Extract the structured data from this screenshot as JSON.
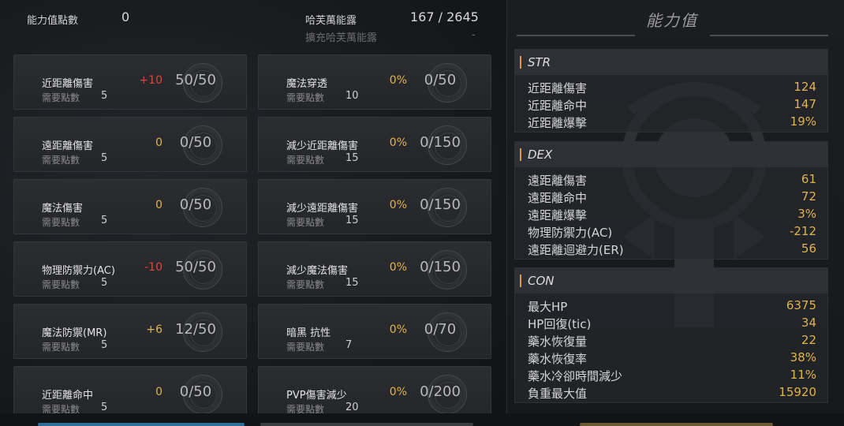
{
  "header": {
    "points_label": "能力值點數",
    "points_value": "0",
    "energy_label": "哈芙萬能露",
    "energy_value": "167 / 2645",
    "expand_label": "擴充哈芙萬能露",
    "expand_value": "-"
  },
  "skills_left": [
    {
      "name": "近距離傷害",
      "req_label": "需要點數",
      "req": "5",
      "bonus": "+10",
      "level": "50/50",
      "tone": "red"
    },
    {
      "name": "遠距離傷害",
      "req_label": "需要點數",
      "req": "5",
      "bonus": "0",
      "level": "0/50",
      "tone": "gold"
    },
    {
      "name": "魔法傷害",
      "req_label": "需要點數",
      "req": "5",
      "bonus": "0",
      "level": "0/50",
      "tone": "gold"
    },
    {
      "name": "物理防禦力(AC)",
      "req_label": "需要點數",
      "req": "5",
      "bonus": "-10",
      "level": "50/50",
      "tone": "red"
    },
    {
      "name": "魔法防禦(MR)",
      "req_label": "需要點數",
      "req": "5",
      "bonus": "+6",
      "level": "12/50",
      "tone": "gold"
    },
    {
      "name": "近距離命中",
      "req_label": "需要點數",
      "req": "5",
      "bonus": "0",
      "level": "0/50",
      "tone": "gold"
    }
  ],
  "skills_right": [
    {
      "name": "魔法穿透",
      "req_label": "需要點數",
      "req": "10",
      "bonus": "0%",
      "level": "0/50",
      "tone": "gold"
    },
    {
      "name": "減少近距離傷害",
      "req_label": "需要點數",
      "req": "15",
      "bonus": "0%",
      "level": "0/150",
      "tone": "gold"
    },
    {
      "name": "減少遠距離傷害",
      "req_label": "需要點數",
      "req": "15",
      "bonus": "0%",
      "level": "0/150",
      "tone": "gold"
    },
    {
      "name": "減少魔法傷害",
      "req_label": "需要點數",
      "req": "15",
      "bonus": "0%",
      "level": "0/150",
      "tone": "gold"
    },
    {
      "name": "暗黑 抗性",
      "req_label": "需要點數",
      "req": "7",
      "bonus": "0%",
      "level": "0/70",
      "tone": "gold"
    },
    {
      "name": "PVP傷害減少",
      "req_label": "需要點數",
      "req": "20",
      "bonus": "0%",
      "level": "0/200",
      "tone": "gold"
    }
  ],
  "stats_panel": {
    "title": "能力值",
    "sections": [
      {
        "label": "STR",
        "rows": [
          {
            "name": "近距離傷害",
            "value": "124"
          },
          {
            "name": "近距離命中",
            "value": "147"
          },
          {
            "name": "近距離爆擊",
            "value": "19%"
          }
        ]
      },
      {
        "label": "DEX",
        "rows": [
          {
            "name": "遠距離傷害",
            "value": "61"
          },
          {
            "name": "遠距離命中",
            "value": "72"
          },
          {
            "name": "遠距離爆擊",
            "value": "3%"
          },
          {
            "name": "物理防禦力(AC)",
            "value": "-212"
          },
          {
            "name": "遠距離迴避力(ER)",
            "value": "56"
          }
        ]
      },
      {
        "label": "CON",
        "rows": [
          {
            "name": "最大HP",
            "value": "6375"
          },
          {
            "name": "HP回復(tic)",
            "value": "34"
          },
          {
            "name": "藥水恢復量",
            "value": "22"
          },
          {
            "name": "藥水恢復率",
            "value": "38%"
          },
          {
            "name": "藥水冷卻時間減少",
            "value": "11%"
          },
          {
            "name": "負重最大值",
            "value": "15920"
          }
        ]
      }
    ]
  },
  "colors": {
    "accent_gold": "#e2b34d",
    "accent_red": "#e0453a",
    "section_bar": "#d79a4a"
  }
}
